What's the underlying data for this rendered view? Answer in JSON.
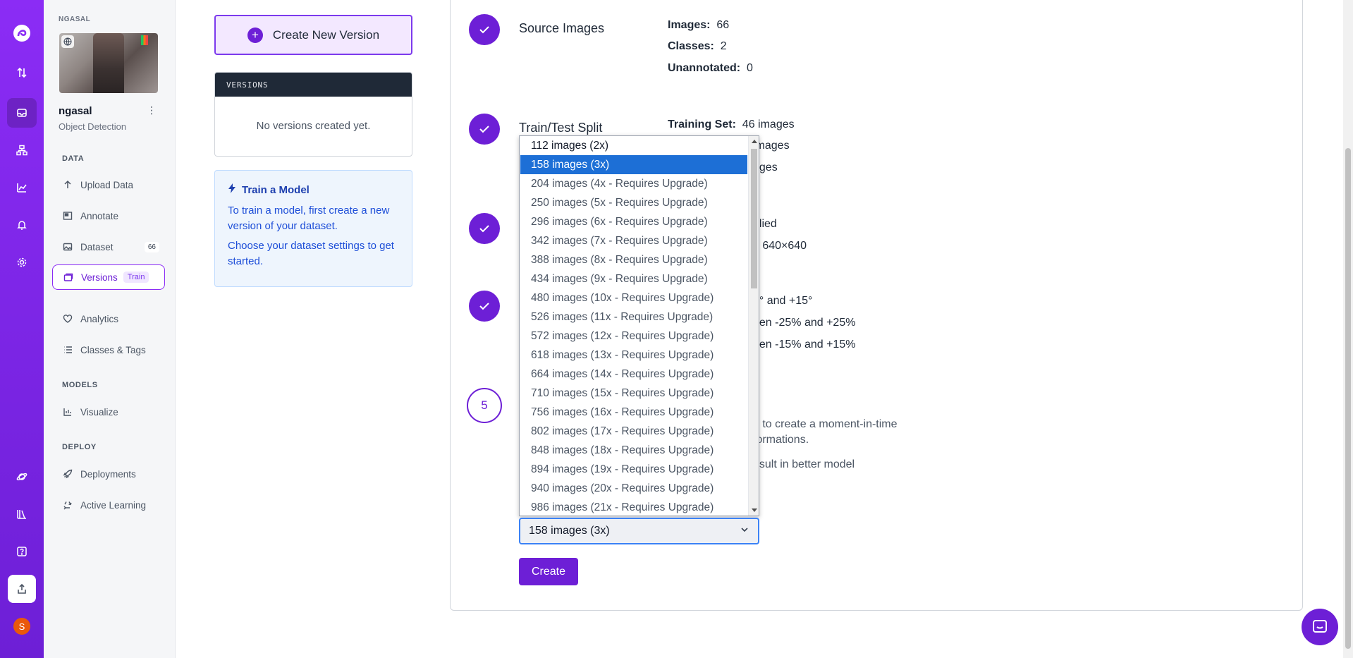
{
  "sidebar": {
    "project_caption": "NGASAL",
    "project_name": "ngasal",
    "project_type": "Object Detection",
    "sections": {
      "data": "DATA",
      "models": "MODELS",
      "deploy": "DEPLOY"
    },
    "items": {
      "upload": "Upload Data",
      "annotate": "Annotate",
      "dataset": "Dataset",
      "dataset_count": "66",
      "versions": "Versions",
      "versions_tag": "Train",
      "analytics": "Analytics",
      "classes": "Classes & Tags",
      "visualize": "Visualize",
      "deployments": "Deployments",
      "active_learning": "Active Learning"
    }
  },
  "rail": {
    "avatar_initial": "S"
  },
  "versions_panel": {
    "create_label": "Create New Version",
    "header": "VERSIONS",
    "empty": "No versions created yet.",
    "train_title": "Train a Model",
    "train_p1": "To train a model, first create a new version of your dataset.",
    "train_p2": "Choose your dataset settings to get started."
  },
  "steps": {
    "source": {
      "title": "Source Images",
      "images_label": "Images:",
      "images_value": "66",
      "classes_label": "Classes:",
      "classes_value": "2",
      "unannotated_label": "Unannotated:",
      "unannotated_value": "0"
    },
    "split": {
      "title": "Train/Test Split",
      "training_label": "Training Set:",
      "training_value": "46 images",
      "row2_tail": "images",
      "row3_tail": "ages"
    },
    "preprocess": {
      "row1_tail": "plied",
      "row2_tail": "o 640×640"
    },
    "augment": {
      "row1_tail": "5° and +15°",
      "row2_tail": "een -25% and +25%",
      "row3_tail": "een -15% and +15%"
    },
    "generate": {
      "number": "5",
      "text1": "e to create a moment-in-time",
      "text2": "formations.",
      "text3": "esult in better model"
    }
  },
  "select": {
    "value": "158 images (3x)",
    "options": [
      "112 images (2x)",
      "158 images (3x)",
      "204 images (4x - Requires Upgrade)",
      "250 images (5x - Requires Upgrade)",
      "296 images (6x - Requires Upgrade)",
      "342 images (7x - Requires Upgrade)",
      "388 images (8x - Requires Upgrade)",
      "434 images (9x - Requires Upgrade)",
      "480 images (10x - Requires Upgrade)",
      "526 images (11x - Requires Upgrade)",
      "572 images (12x - Requires Upgrade)",
      "618 images (13x - Requires Upgrade)",
      "664 images (14x - Requires Upgrade)",
      "710 images (15x - Requires Upgrade)",
      "756 images (16x - Requires Upgrade)",
      "802 images (17x - Requires Upgrade)",
      "848 images (18x - Requires Upgrade)",
      "894 images (19x - Requires Upgrade)",
      "940 images (20x - Requires Upgrade)",
      "986 images (21x - Requires Upgrade)"
    ],
    "selected_index": 1
  },
  "create_button": "Create",
  "colors": {
    "brand": "#6d1fd6",
    "selected": "#1d6fd6",
    "info_bg": "#eef5fd"
  }
}
